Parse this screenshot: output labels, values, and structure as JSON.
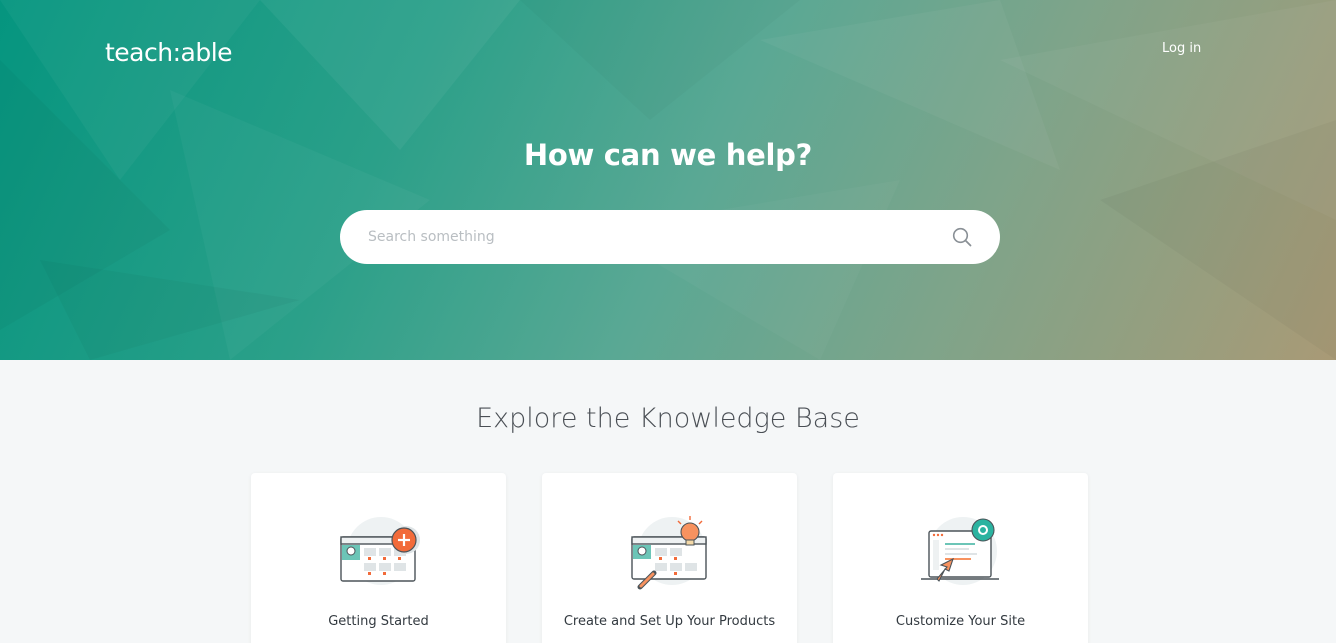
{
  "header": {
    "logo_text": "teach:able",
    "login_label": "Log in"
  },
  "hero": {
    "headline": "How can we help?",
    "search_placeholder": "Search something"
  },
  "knowledge_base": {
    "title": "Explore the Knowledge Base",
    "cards": [
      {
        "label": "Getting Started",
        "icon": "getting-started-illustration"
      },
      {
        "label": "Create and Set Up Your Products",
        "icon": "products-illustration"
      },
      {
        "label": "Customize Your Site",
        "icon": "customize-site-illustration"
      }
    ]
  },
  "colors": {
    "hero_start": "#05957f",
    "hero_end": "#a99a76",
    "accent_orange": "#f26b3a",
    "accent_teal": "#2bb3a0",
    "page_bg": "#f5f7f8"
  }
}
